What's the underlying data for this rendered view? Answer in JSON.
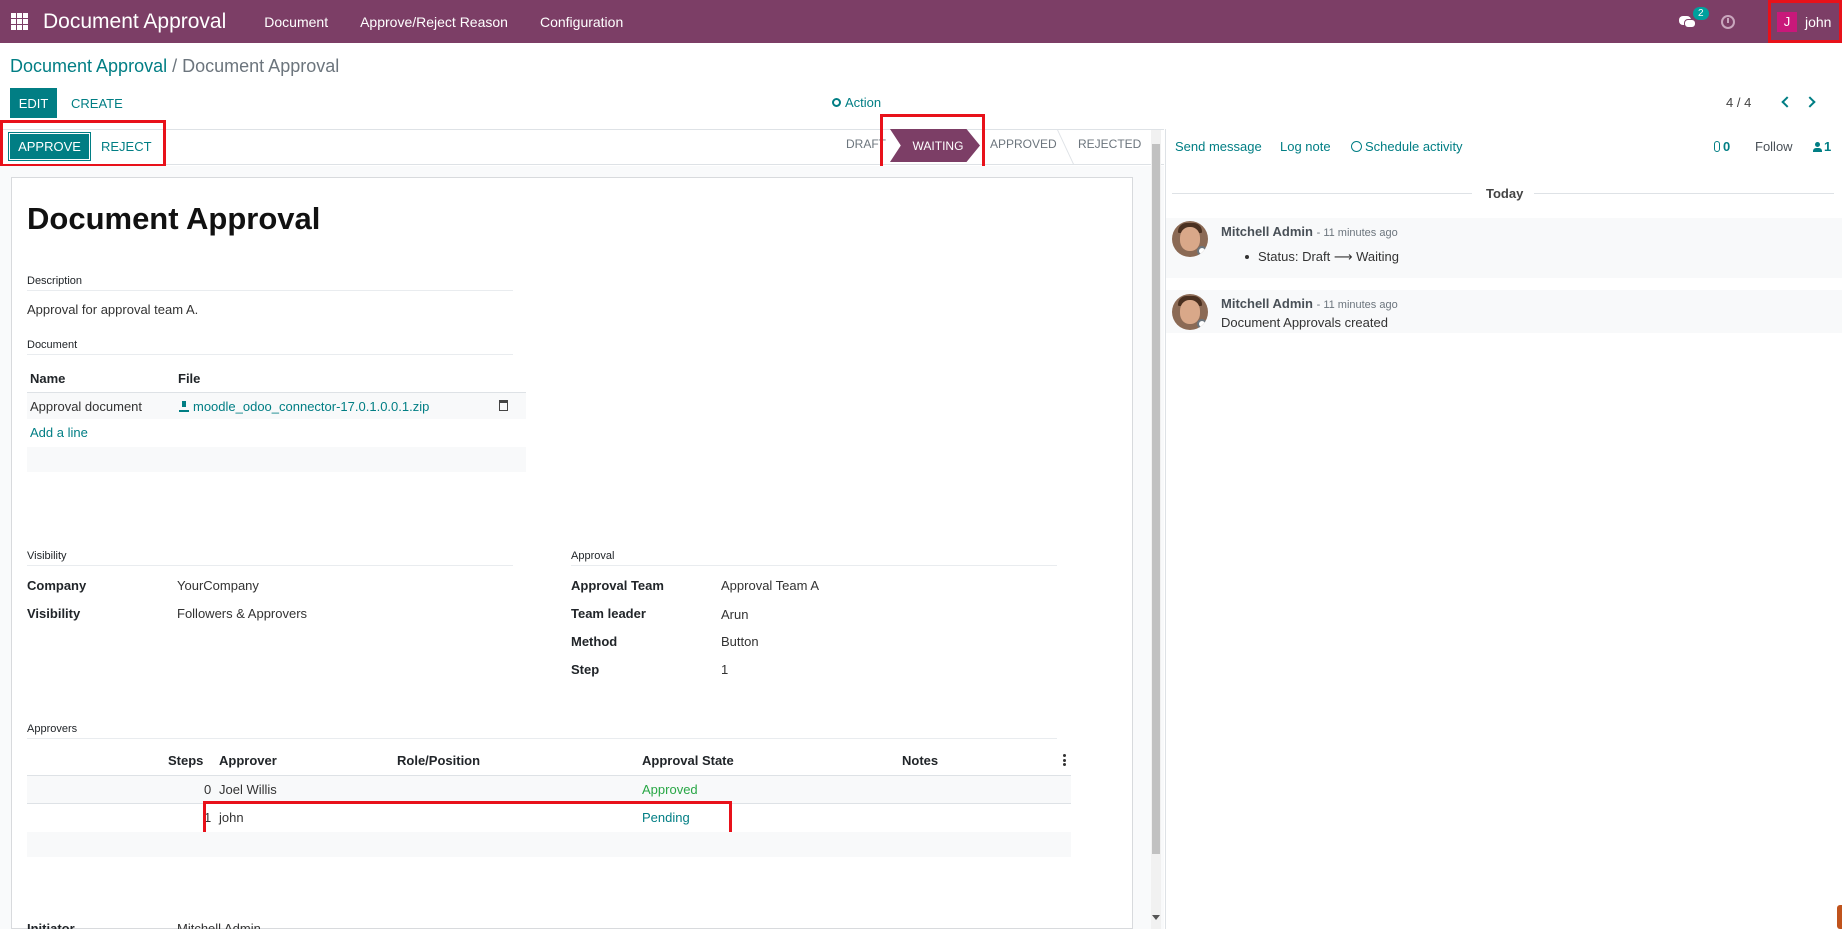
{
  "navbar": {
    "brand": "Document Approval",
    "menus": [
      "Document",
      "Approve/Reject Reason",
      "Configuration"
    ],
    "chat_count": "2",
    "user_initial": "J",
    "user_name": "john"
  },
  "breadcrumb": {
    "parent": "Document Approval",
    "separator": "/",
    "current": "Document Approval"
  },
  "control": {
    "edit": "EDIT",
    "create": "CREATE",
    "action": "Action",
    "pager": "4 / 4"
  },
  "status": {
    "approve": "APPROVE",
    "reject": "REJECT",
    "stages": [
      "DRAFT",
      "WAITING",
      "APPROVED",
      "REJECTED"
    ]
  },
  "form": {
    "title": "Document Approval",
    "description_label": "Description",
    "description": "Approval for approval team A.",
    "document_label": "Document",
    "doc_columns": [
      "Name",
      "File"
    ],
    "doc_rows": [
      {
        "name": "Approval document",
        "file": "moodle_odoo_connector-17.0.1.0.0.1.zip"
      }
    ],
    "add_line": "Add a line",
    "visibility_label": "Visibility",
    "company_label": "Company",
    "company": "YourCompany",
    "visibility_field": "Visibility",
    "visibility": "Followers & Approvers",
    "approval_label": "Approval",
    "approval_team_label": "Approval Team",
    "approval_team": "Approval Team A",
    "team_leader_label": "Team leader",
    "team_leader": "Arun",
    "method_label": "Method",
    "method": "Button",
    "step_label": "Step",
    "step": "1",
    "approvers_label": "Approvers",
    "approver_columns": [
      "Steps",
      "Approver",
      "Role/Position",
      "Approval State",
      "Notes"
    ],
    "approver_rows": [
      {
        "step": "0",
        "approver": "Joel Willis",
        "state": "Approved"
      },
      {
        "step": "1",
        "approver": "john",
        "state": "Pending"
      }
    ],
    "initiator_label": "Initiator",
    "initiator": "Mitchell Admin"
  },
  "chatter": {
    "send_message": "Send message",
    "log_note": "Log note",
    "schedule_activity": "Schedule activity",
    "attachments": "0",
    "follow": "Follow",
    "followers": "1",
    "today": "Today",
    "messages": [
      {
        "author": "Mitchell Admin",
        "ago": "- 11 minutes ago",
        "body": "Status: Draft ⟶ Waiting"
      },
      {
        "author": "Mitchell Admin",
        "ago": "- 11 minutes ago",
        "body": "Document Approvals created"
      }
    ]
  },
  "colors": {
    "brand": "#7c3e66",
    "accent": "#017e84",
    "highlight": "#e8111a",
    "approved": "#28a745"
  }
}
